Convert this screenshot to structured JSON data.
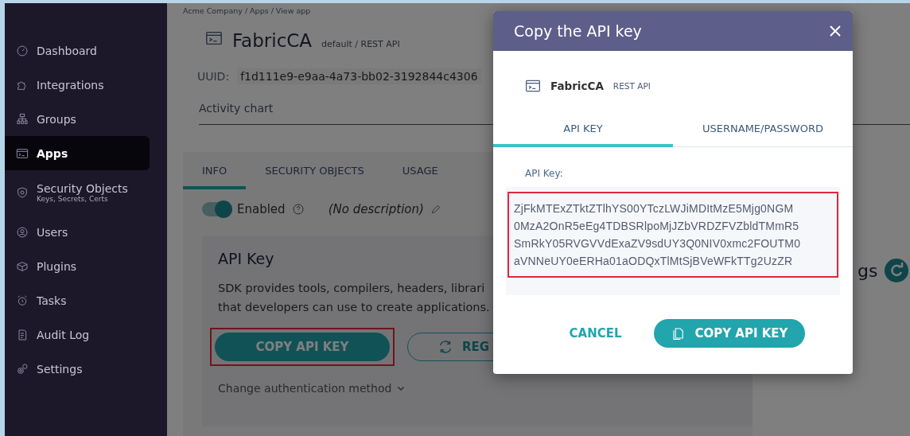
{
  "sidebar": {
    "items": [
      {
        "label": "Dashboard",
        "selected": false
      },
      {
        "label": "Integrations",
        "selected": false
      },
      {
        "label": "Groups",
        "selected": false
      },
      {
        "label": "Apps",
        "selected": true
      },
      {
        "label": "Security Objects",
        "subtitle": "Keys, Secrets, Certs",
        "selected": false
      },
      {
        "label": "Users",
        "selected": false
      },
      {
        "label": "Plugins",
        "selected": false
      },
      {
        "label": "Tasks",
        "selected": false
      },
      {
        "label": "Audit Log",
        "selected": false
      },
      {
        "label": "Settings",
        "selected": false
      }
    ]
  },
  "breadcrumb": "Acme Company / Apps / View app",
  "app": {
    "name": "FabricCA",
    "subtitle": "default / REST API",
    "uuid_label": "UUID:",
    "uuid": "f1d111e9-e9aa-4a73-bb02-3192844c4306",
    "activity_label": "Activity chart"
  },
  "tabs": [
    {
      "label": "INFO",
      "selected": true
    },
    {
      "label": "SECURITY OBJECTS",
      "selected": false
    },
    {
      "label": "USAGE",
      "selected": false
    }
  ],
  "enabled_toggle": {
    "label": "Enabled",
    "on": true
  },
  "description": "(No description)",
  "api_key_card": {
    "title": "API Key",
    "description_lines": [
      "SDK provides tools, compilers, headers, librari",
      "that developers can use to create applications."
    ],
    "copy_button": {
      "label": "COPY API KEY",
      "highlighted": true
    },
    "regenerate_button": {
      "label": "REG"
    },
    "change_auth": "Change authentication method"
  },
  "side_panel": {
    "title_fragment": "gs"
  },
  "dialog": {
    "title": "Copy the API key",
    "app_name": "FabricCA",
    "app_type": "REST API",
    "tabs": [
      {
        "label": "API KEY",
        "selected": true
      },
      {
        "label": "USERNAME/PASSWORD",
        "selected": false
      }
    ],
    "key_label": "API Key:",
    "key_lines": [
      "ZjFkMTExZTktZTlhYS00YTczLWJiMDItMzE5Mjg0NGM",
      "0MzA2OnR5eEg4TDBSRlpoMjJZbVRDZFVZbldTMmR5",
      "SmRkY05RVGVVdExaZV9sdUY3Q0NIV0xmc2FOUTM0",
      "aVNNeUY0eERHa01aODQxTlMtSjBVeWFkTTg2UzZR"
    ],
    "key_highlighted": true,
    "buttons": [
      {
        "kind": "text",
        "label": "CANCEL"
      },
      {
        "kind": "primary",
        "label": "COPY API KEY"
      }
    ]
  }
}
